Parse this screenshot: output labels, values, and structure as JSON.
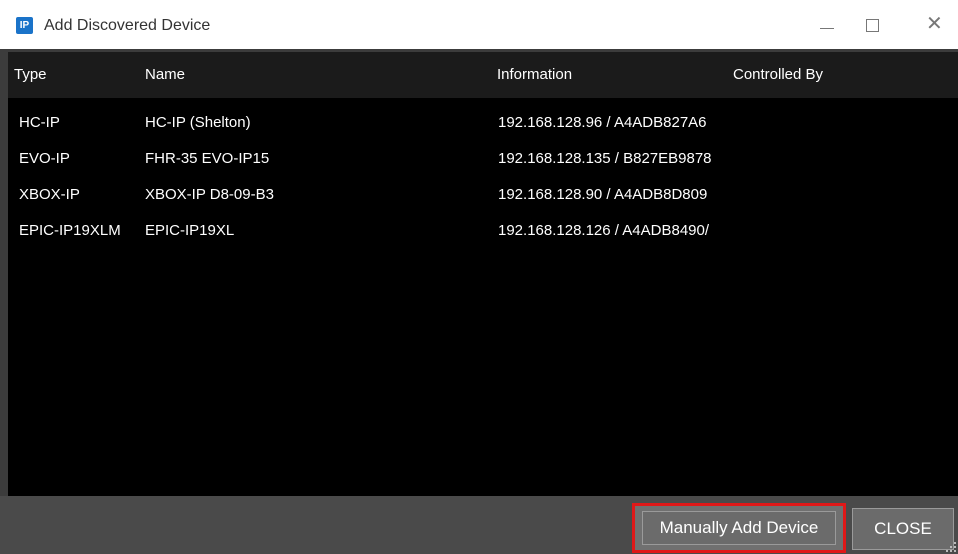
{
  "window": {
    "title": "Add Discovered Device",
    "icon_label": "IP"
  },
  "table": {
    "columns": [
      "Type",
      "Name",
      "Information",
      "Controlled By"
    ],
    "rows": [
      {
        "type": "HC-IP",
        "name": "HC-IP (Shelton)",
        "information": "192.168.128.96 / A4ADB827A6",
        "controlled_by": ""
      },
      {
        "type": "EVO-IP",
        "name": "FHR-35 EVO-IP15",
        "information": "192.168.128.135 / B827EB9878",
        "controlled_by": ""
      },
      {
        "type": "XBOX-IP",
        "name": "XBOX-IP D8-09-B3",
        "information": "192.168.128.90 / A4ADB8D809",
        "controlled_by": ""
      },
      {
        "type": "EPIC-IP19XLM",
        "name": "EPIC-IP19XL",
        "information": "192.168.128.126 / A4ADB8490/",
        "controlled_by": ""
      }
    ]
  },
  "buttons": {
    "manual_add": "Manually Add Device",
    "close": "CLOSE"
  },
  "colors": {
    "highlight_border": "#e01818",
    "table_background": "#000000",
    "frame_background": "#3c3c3c"
  }
}
